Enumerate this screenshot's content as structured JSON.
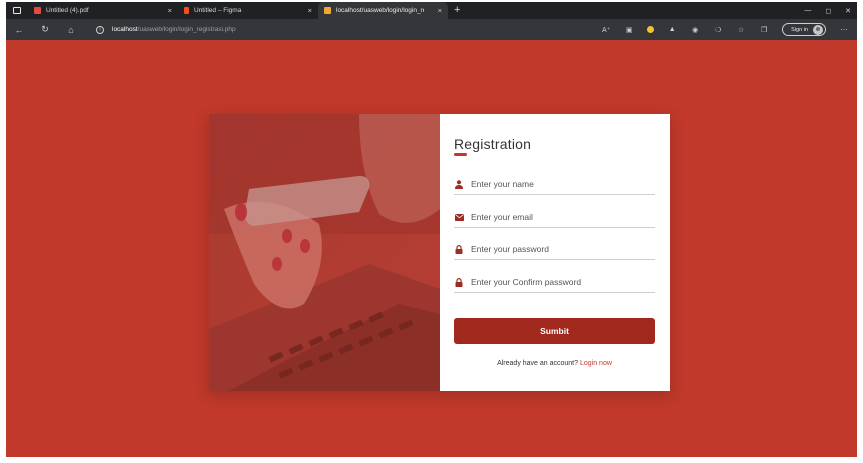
{
  "browser": {
    "tabs": [
      {
        "title": "Untitled (4).pdf",
        "favicon_color": "#e34c3c"
      },
      {
        "title": "Untitled – Figma",
        "favicon_color": "#f24e1e"
      },
      {
        "title": "localhost/uasweb/login/login_re",
        "favicon_color": "#f0a830"
      }
    ],
    "tab_close_glyph": "×",
    "new_tab_glyph": "+",
    "address": {
      "host": "localhost",
      "path": "/uasweb/login/login_registrasi.php"
    },
    "signin_label": "Sign in"
  },
  "form": {
    "title": "Registration",
    "fields": [
      {
        "placeholder": "Enter your name",
        "icon": "user-icon"
      },
      {
        "placeholder": "Enter your email",
        "icon": "envelope-icon"
      },
      {
        "placeholder": "Enter your password",
        "icon": "lock-icon"
      },
      {
        "placeholder": "Enter your Confirm password",
        "icon": "lock-icon"
      }
    ],
    "submit_label": "Sumbit",
    "login_prompt": "Already have an account?",
    "login_link": "Login now"
  },
  "colors": {
    "page_bg": "#c0392b",
    "button": "#a1281d",
    "accent": "#c0392b"
  }
}
